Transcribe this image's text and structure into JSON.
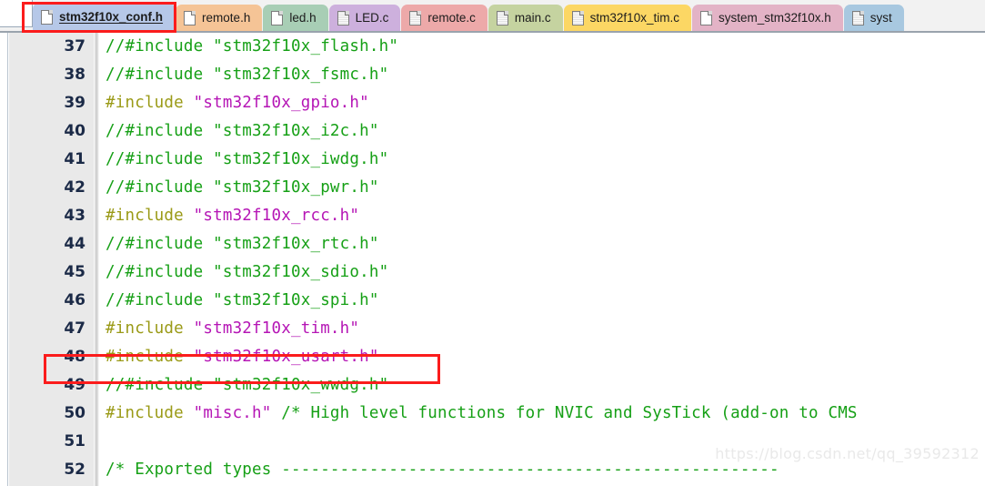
{
  "tabbar": {
    "tabs": [
      {
        "label": "stm32f10x_conf.h",
        "color": "#b6c8e8",
        "icon": "file-icon",
        "icon_style": "plain",
        "active": true
      },
      {
        "label": "remote.h",
        "color": "#f5c496",
        "icon": "file-icon",
        "icon_style": "plain",
        "active": false
      },
      {
        "label": "led.h",
        "color": "#a8ceb5",
        "icon": "file-icon",
        "icon_style": "plain",
        "active": false
      },
      {
        "label": "LED.c",
        "color": "#cdb0dd",
        "icon": "file-icon",
        "icon_style": "shaded",
        "active": false
      },
      {
        "label": "remote.c",
        "color": "#eda9a9",
        "icon": "file-icon",
        "icon_style": "shaded",
        "active": false
      },
      {
        "label": "main.c",
        "color": "#c5d3a0",
        "icon": "file-icon",
        "icon_style": "shaded",
        "active": false
      },
      {
        "label": "stm32f10x_tim.c",
        "color": "#fcd764",
        "icon": "file-icon",
        "icon_style": "shaded",
        "active": false
      },
      {
        "label": "system_stm32f10x.h",
        "color": "#e3b3c6",
        "icon": "file-icon",
        "icon_style": "plain",
        "active": false
      },
      {
        "label": "syst",
        "color": "#a8c8e0",
        "icon": "file-icon",
        "icon_style": "shaded",
        "active": false
      }
    ]
  },
  "editor": {
    "lines": [
      {
        "num": "37",
        "tokens": [
          {
            "t": "//#include \"stm32f10x_flash.h\"",
            "c": "c-comment"
          }
        ]
      },
      {
        "num": "38",
        "tokens": [
          {
            "t": "//#include \"stm32f10x_fsmc.h\"",
            "c": "c-comment"
          }
        ]
      },
      {
        "num": "39",
        "tokens": [
          {
            "t": "#include ",
            "c": "c-pp"
          },
          {
            "t": "\"stm32f10x_gpio.h\"",
            "c": "c-str"
          }
        ]
      },
      {
        "num": "40",
        "tokens": [
          {
            "t": "//#include \"stm32f10x_i2c.h\"",
            "c": "c-comment"
          }
        ]
      },
      {
        "num": "41",
        "tokens": [
          {
            "t": "//#include \"stm32f10x_iwdg.h\"",
            "c": "c-comment"
          }
        ]
      },
      {
        "num": "42",
        "tokens": [
          {
            "t": "//#include \"stm32f10x_pwr.h\"",
            "c": "c-comment"
          }
        ]
      },
      {
        "num": "43",
        "tokens": [
          {
            "t": "#include ",
            "c": "c-pp"
          },
          {
            "t": "\"stm32f10x_rcc.h\"",
            "c": "c-str"
          }
        ]
      },
      {
        "num": "44",
        "tokens": [
          {
            "t": "//#include \"stm32f10x_rtc.h\"",
            "c": "c-comment"
          }
        ]
      },
      {
        "num": "45",
        "tokens": [
          {
            "t": "//#include \"stm32f10x_sdio.h\"",
            "c": "c-comment"
          }
        ]
      },
      {
        "num": "46",
        "tokens": [
          {
            "t": "//#include \"stm32f10x_spi.h\"",
            "c": "c-comment"
          }
        ]
      },
      {
        "num": "47",
        "tokens": [
          {
            "t": "#include ",
            "c": "c-pp"
          },
          {
            "t": "\"stm32f10x_tim.h\"",
            "c": "c-str"
          }
        ]
      },
      {
        "num": "48",
        "tokens": [
          {
            "t": "#include ",
            "c": "c-pp"
          },
          {
            "t": "\"stm32f10x_usart.h\"",
            "c": "c-str"
          }
        ]
      },
      {
        "num": "49",
        "tokens": [
          {
            "t": "//#include \"stm32f10x_wwdg.h\"",
            "c": "c-comment"
          }
        ]
      },
      {
        "num": "50",
        "tokens": [
          {
            "t": "#include ",
            "c": "c-pp"
          },
          {
            "t": "\"misc.h\"",
            "c": "c-str"
          },
          {
            "t": " /* High level functions for NVIC and SysTick (add-on to CMS",
            "c": "c-comment"
          }
        ]
      },
      {
        "num": "51",
        "tokens": []
      },
      {
        "num": "52",
        "tokens": [
          {
            "t": "/* Exported types ---------------------------------------------------",
            "c": "c-comment"
          }
        ]
      }
    ]
  },
  "annotations": {
    "color": "#fb1c1c",
    "tab_highlight_target": "stm32f10x_conf.h",
    "line_highlight_target": "47"
  },
  "watermark": {
    "text": "https://blog.csdn.net/qq_39592312"
  }
}
